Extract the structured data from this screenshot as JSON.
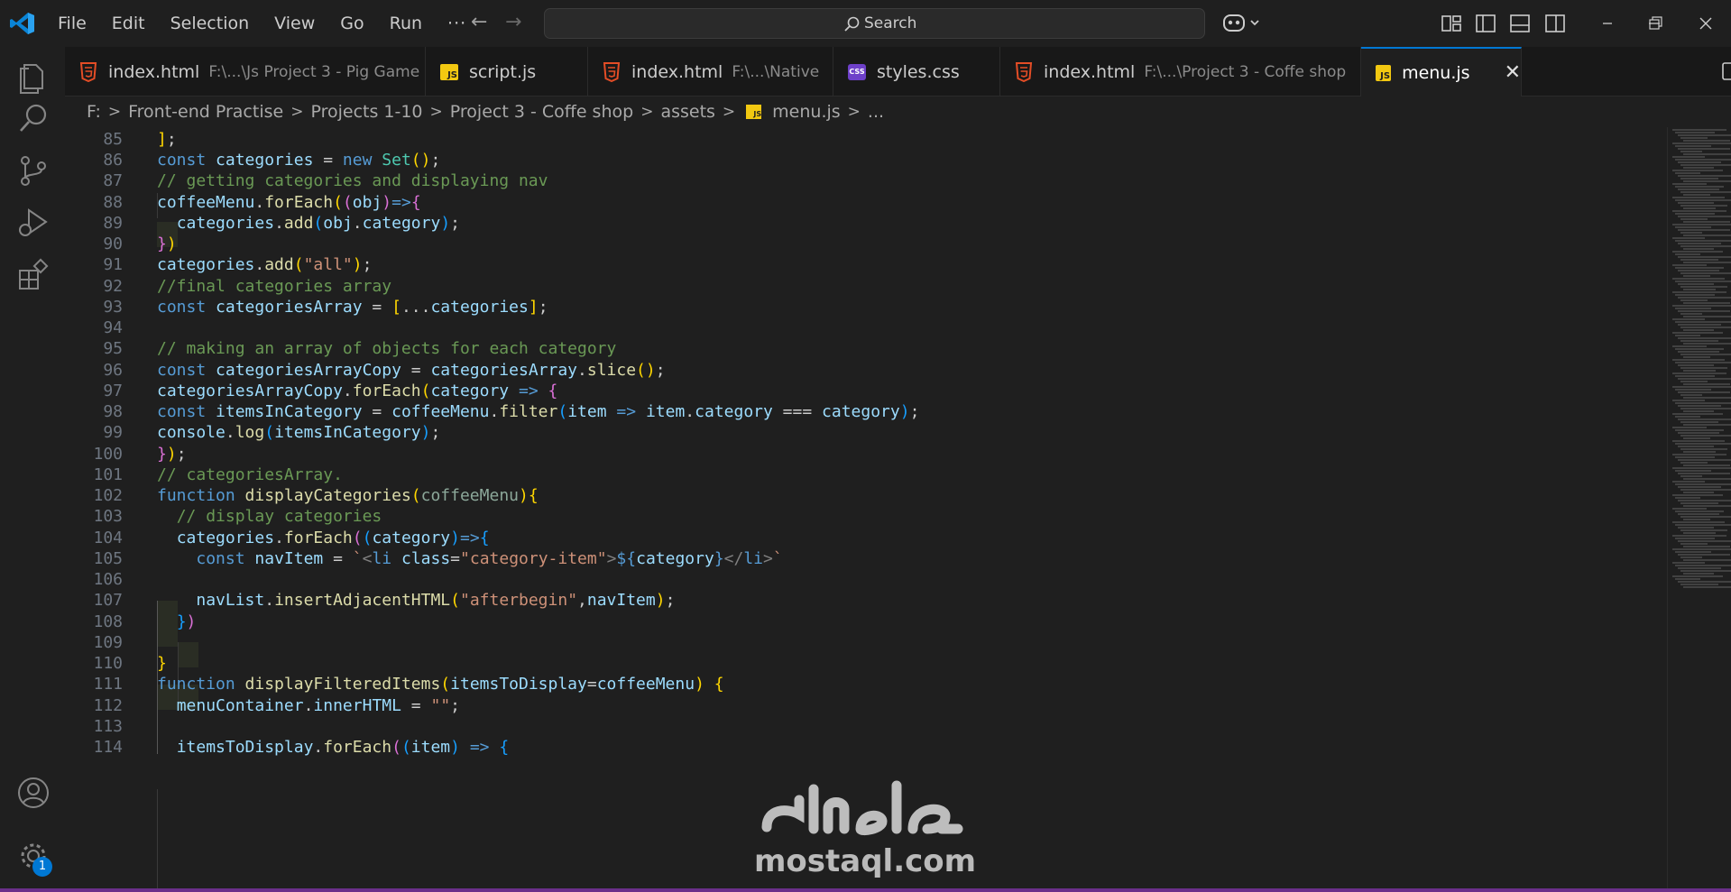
{
  "menu": {
    "file": "File",
    "edit": "Edit",
    "selection": "Selection",
    "view": "View",
    "go": "Go",
    "run": "Run",
    "more": "···"
  },
  "search": {
    "label": "Search"
  },
  "tabs": [
    {
      "name": "index.html",
      "path": "F:\\...\\Js Project 3 - Pig Game",
      "icon": "html5-icon"
    },
    {
      "name": "script.js",
      "path": "",
      "icon": "js-icon"
    },
    {
      "name": "index.html",
      "path": "F:\\...\\Native",
      "icon": "html5-icon"
    },
    {
      "name": "styles.css",
      "path": "",
      "icon": "css-icon"
    },
    {
      "name": "index.html",
      "path": "F:\\...\\Project 3 - Coffe shop",
      "icon": "html5-icon"
    },
    {
      "name": "menu.js",
      "path": "",
      "icon": "js-icon",
      "active": true,
      "close": "✕"
    }
  ],
  "breadcrumb": {
    "items": [
      "F:",
      "Front-end Practise",
      "Projects 1-10",
      "Project 3 - Coffe shop",
      "assets",
      "menu.js",
      "..."
    ],
    "sep": ">"
  },
  "editor": {
    "line_numbers": [
      "85",
      "86",
      "87",
      "88",
      "89",
      "90",
      "91",
      "92",
      "93",
      "94",
      "95",
      "96",
      "97",
      "98",
      "99",
      "100",
      "101",
      "102",
      "103",
      "104",
      "105",
      "106",
      "107",
      "108",
      "109",
      "110",
      "111",
      "112",
      "113",
      "114"
    ]
  },
  "activity_badge": "1",
  "watermark": {
    "text": "mostaql.com"
  },
  "colors": {
    "background": "#1f1f1f",
    "accent": "#0078d4",
    "keyword": "#569cd6",
    "string": "#ce9178",
    "comment": "#6a9955",
    "function": "#dcdcaa",
    "variable": "#9cdcfe"
  }
}
